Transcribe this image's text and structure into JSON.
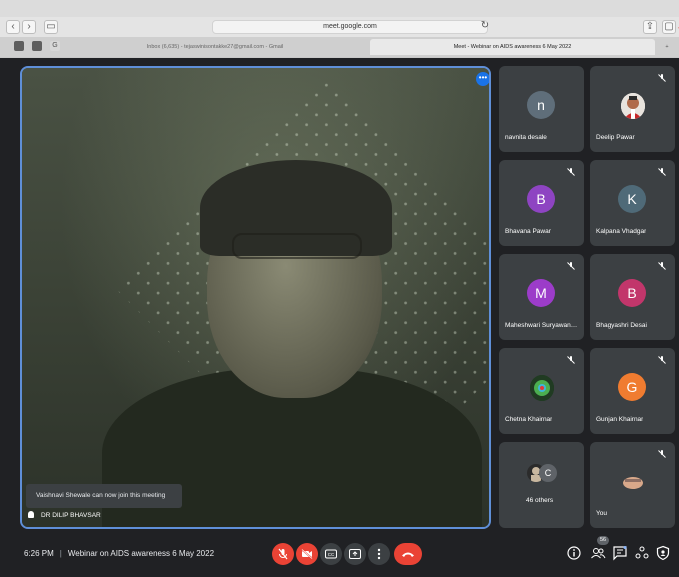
{
  "browser": {
    "url": "meet.google.com",
    "tabs": [
      {
        "label": "Inbox (6,635) - tejaswinisontakke27@gmail.com - Gmail",
        "active": false
      },
      {
        "label": "Meet - Webinar on AIDS awareness 6 May 2022",
        "active": true
      }
    ],
    "pinned_tabs": [
      "1",
      "3",
      "G"
    ]
  },
  "main_tile": {
    "speaker_name": "DR DILIP BHAVSAR",
    "notification": "Vaishnavi Shewale can now join this meeting",
    "more_label": "•••"
  },
  "participants": [
    {
      "name": "navnita desale",
      "initial": "n",
      "color": "#5f6e7a",
      "muted": false,
      "type": "initial"
    },
    {
      "name": "Deelip Pawar",
      "initial": "",
      "color": "#b24a3a",
      "muted": true,
      "type": "photo"
    },
    {
      "name": "Bhavana Pawar",
      "initial": "B",
      "color": "#8e44c2",
      "muted": true,
      "type": "initial"
    },
    {
      "name": "Kalpana Vhadgar",
      "initial": "K",
      "color": "#4f6a78",
      "muted": true,
      "type": "initial"
    },
    {
      "name": "Maheshwari Suryawan…",
      "initial": "M",
      "color": "#9c3cc9",
      "muted": true,
      "type": "initial"
    },
    {
      "name": "Bhagyashri Desai",
      "initial": "B",
      "color": "#c2366b",
      "muted": true,
      "type": "initial"
    },
    {
      "name": "Chetna Khairnar",
      "initial": "",
      "color": "#2e7d32",
      "muted": true,
      "type": "photo"
    },
    {
      "name": "Gunjan Khairnar",
      "initial": "G",
      "color": "#f07c30",
      "muted": true,
      "type": "initial"
    },
    {
      "name": "46 others",
      "initial": "C",
      "color": "#5f6368",
      "muted": false,
      "type": "others"
    },
    {
      "name": "You",
      "initial": "",
      "color": "#8d6e63",
      "muted": true,
      "type": "photo"
    }
  ],
  "bottom_bar": {
    "time": "6:26 PM",
    "separator": "|",
    "meeting_title": "Webinar on AIDS awareness 6 May 2022",
    "participant_count": "56",
    "icons": {
      "mic": "mic-off-icon",
      "camera": "camera-off-icon",
      "captions": "captions-icon",
      "present": "present-icon",
      "more": "more-vert-icon",
      "leave": "leave-call-icon",
      "info": "info-icon",
      "people": "people-icon",
      "chat": "chat-icon",
      "activities": "activities-icon",
      "host": "host-controls-icon"
    }
  },
  "colors": {
    "meet_bg": "#202124",
    "tile_bg": "#3c4043",
    "accent_blue": "#1a73e8",
    "red": "#ea4335"
  }
}
